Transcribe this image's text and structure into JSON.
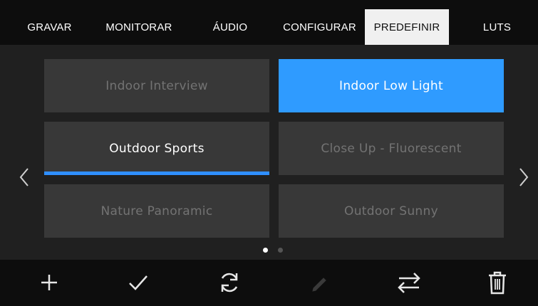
{
  "tabs": [
    {
      "label": "GRAVAR"
    },
    {
      "label": "MONITORAR"
    },
    {
      "label": "ÁUDIO"
    },
    {
      "label": "CONFIGURAR"
    },
    {
      "label": "PREDEFINIR",
      "active": true
    },
    {
      "label": "LUTS"
    }
  ],
  "presets": [
    {
      "label": "Indoor Interview"
    },
    {
      "label": "Indoor Low Light",
      "state": "selected"
    },
    {
      "label": "Outdoor Sports",
      "state": "loaded"
    },
    {
      "label": "Close Up - Fluorescent"
    },
    {
      "label": "Nature Panoramic"
    },
    {
      "label": "Outdoor Sunny"
    }
  ],
  "pagination": {
    "current_page": 1,
    "total_pages": 2
  },
  "toolbar": [
    {
      "icon": "plus-icon",
      "enabled": true
    },
    {
      "icon": "checkmark-icon",
      "enabled": true
    },
    {
      "icon": "refresh-icon",
      "enabled": true
    },
    {
      "icon": "pencil-icon",
      "enabled": false
    },
    {
      "icon": "swap-arrows-icon",
      "enabled": true
    },
    {
      "icon": "trash-icon",
      "enabled": true
    }
  ],
  "colors": {
    "accent": "#2f9bff",
    "tab_active_bg": "#f0f0f0",
    "preset_bg": "#383838",
    "preset_inactive_text": "#737373"
  }
}
